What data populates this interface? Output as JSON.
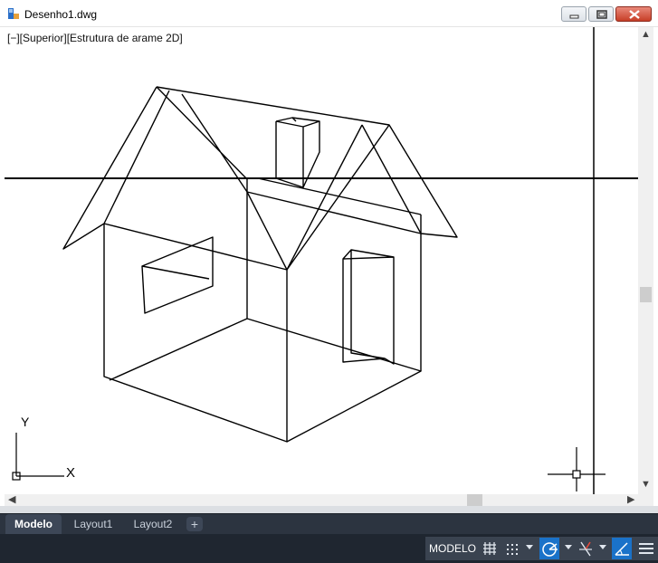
{
  "window": {
    "title": "Desenho1.dwg",
    "icon": "autocad-app-icon",
    "buttons": [
      "minimize-icon",
      "maximize-icon",
      "close-icon"
    ]
  },
  "viewport": {
    "label": "[−][Superior][Estrutura de arame 2D]",
    "ucs": {
      "x_label": "X",
      "y_label": "Y"
    }
  },
  "tabs": [
    {
      "label": "Modelo",
      "active": true
    },
    {
      "label": "Layout1",
      "active": false
    },
    {
      "label": "Layout2",
      "active": false
    }
  ],
  "tab_add_label": "+",
  "statusbar": {
    "model_label": "MODELO",
    "icons": [
      "grid-icon",
      "snap-icon",
      "polar-tracking-icon",
      "ortho-icon",
      "isodraft-icon",
      "menu-icon"
    ]
  },
  "colors": {
    "accent": "#1a72c9",
    "statusbar": "#1f2630",
    "tabbar": "#2c3440"
  }
}
